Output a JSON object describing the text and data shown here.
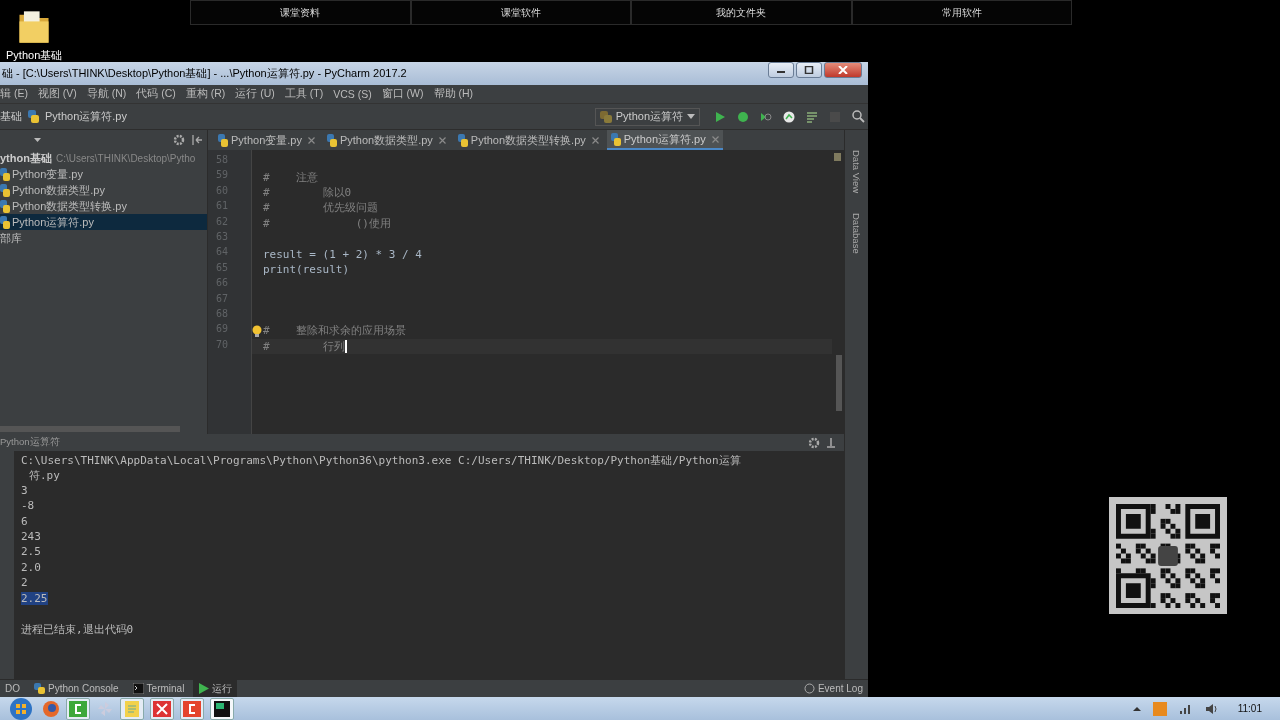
{
  "desktop_icon": {
    "label": "Python基础"
  },
  "top_bar": [
    "课堂资料",
    "课堂软件",
    "我的文件夹",
    "常用软件"
  ],
  "window": {
    "title": "础 - [C:\\Users\\THINK\\Desktop\\Python基础] - ...\\Python运算符.py - PyCharm 2017.2"
  },
  "menu": [
    "辑 (E)",
    "视图 (V)",
    "导航 (N)",
    "代码 (C)",
    "重构 (R)",
    "运行 (U)",
    "工具 (T)",
    "VCS (S)",
    "窗口 (W)",
    "帮助 (H)"
  ],
  "navbar": {
    "project": "基础",
    "file": "Python运算符.py",
    "run_config": "Python运算符"
  },
  "project": {
    "root": {
      "name": "ython基础",
      "path": "C:\\Users\\THINK\\Desktop\\Pytho",
      "children": [
        {
          "name": "Python变量.py",
          "selected": false
        },
        {
          "name": "Python数据类型.py",
          "selected": false
        },
        {
          "name": "Python数据类型转换.py",
          "selected": false
        },
        {
          "name": "Python运算符.py",
          "selected": true
        }
      ]
    },
    "external": "部库"
  },
  "tabs": [
    {
      "label": "Python变量.py",
      "selected": false
    },
    {
      "label": "Python数据类型.py",
      "selected": false
    },
    {
      "label": "Python数据类型转换.py",
      "selected": false
    },
    {
      "label": "Python运算符.py",
      "selected": true
    }
  ],
  "editor": {
    "lines": [
      {
        "number": "58",
        "current": false,
        "hint": false
      },
      {
        "number": "59",
        "kind": "comment",
        "text": "#    注意",
        "current": false,
        "hint": false
      },
      {
        "number": "60",
        "kind": "comment",
        "text": "#        除以0",
        "current": false,
        "hint": false
      },
      {
        "number": "61",
        "kind": "comment",
        "text": "#        优先级问题",
        "current": false,
        "hint": false
      },
      {
        "number": "62",
        "kind": "comment",
        "text": "#             ()使用",
        "current": false,
        "hint": false
      },
      {
        "number": "63",
        "current": false,
        "hint": false
      },
      {
        "number": "64",
        "kind": "code",
        "text": "result = (1 + 2) * 3 / 4",
        "current": false,
        "hint": false
      },
      {
        "number": "65",
        "kind": "code",
        "text": "print(result)",
        "current": false,
        "hint": false
      },
      {
        "number": "66",
        "current": false,
        "hint": false
      },
      {
        "number": "67",
        "current": false,
        "hint": false
      },
      {
        "number": "68",
        "current": false,
        "hint": false
      },
      {
        "number": "69",
        "kind": "comment",
        "text": "#    整除和求余的应用场景",
        "current": false,
        "hint": true
      },
      {
        "number": "70",
        "kind": "comment",
        "text": "#        行列",
        "current": true,
        "hint": false
      }
    ]
  },
  "side_tools": [
    "Data View",
    "Database"
  ],
  "run_panel": {
    "title": "Python运算符",
    "lines": [
      {
        "kind": "output",
        "text": "C:\\Users\\THINK\\AppData\\Local\\Programs\\Python\\Python36\\python3.exe C:/Users/THINK/Desktop/Python基础/Python运算",
        "selected": false
      },
      {
        "kind": "wrap",
        "text": "符.py",
        "selected": false
      },
      {
        "kind": "output",
        "text": "3",
        "selected": false
      },
      {
        "kind": "output",
        "text": "-8",
        "selected": false
      },
      {
        "kind": "output",
        "text": "6",
        "selected": false
      },
      {
        "kind": "output",
        "text": "243",
        "selected": false
      },
      {
        "kind": "output",
        "text": "2.5",
        "selected": false
      },
      {
        "kind": "output",
        "text": "2.0",
        "selected": false
      },
      {
        "kind": "output",
        "text": "2",
        "selected": false
      },
      {
        "kind": "output",
        "text": "2.25",
        "selected": true
      },
      {
        "kind": "exit",
        "text": "进程已结束,退出代码0",
        "selected": false
      }
    ]
  },
  "tool_tabs": [
    {
      "label": "DO",
      "kind": "plain",
      "selected": false
    },
    {
      "label": "Python Console",
      "kind": "python",
      "selected": false
    },
    {
      "label": "Terminal",
      "kind": "terminal",
      "selected": false
    },
    {
      "label": "运行",
      "kind": "run",
      "selected": true
    }
  ],
  "event_log": "Event Log",
  "clock": "11:01"
}
